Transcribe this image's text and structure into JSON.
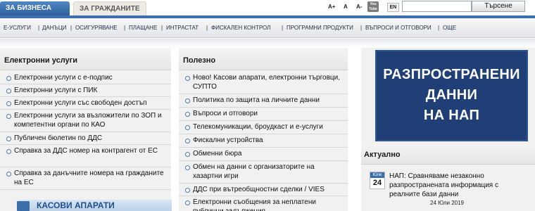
{
  "tabs": {
    "business": "ЗА БИЗНЕСА",
    "citizens": "ЗА ГРАЖДАНИТЕ"
  },
  "toolbar": {
    "font_increase": "A+",
    "font_normal": "A",
    "font_decrease": "A-",
    "youtube_top": "You",
    "youtube_bottom": "Tube",
    "language": "EN",
    "search_value": "",
    "search_button": "Търсене"
  },
  "nav": {
    "items": [
      "Е-УСЛУГИ",
      "ДАНЪЦИ",
      "ОСИГУРЯВАНЕ",
      "ПЛАЩАНЕ",
      "ИНТРАСТАТ",
      "ФИСКАЛЕН КОНТРОЛ",
      "ПРОГРАМНИ ПРОДУКТИ",
      "ВЪПРОСИ И ОТГОВОРИ",
      "ОЩЕ"
    ],
    "separator": "|"
  },
  "left_panel": {
    "title": "Електронни услуги",
    "items": [
      "Електронни услуги с е-подпис",
      "Електронни услуги с ПИК",
      "Електронни услуги със свободен достъп",
      "Електронни услуги за възложители по ЗОП и компетентни органи по КАО",
      "Публичен бюлетин по ДДС",
      "Справка за ДДС номер на контрагент от ЕС",
      "Справка за данъчните номера на гражданите на ЕС"
    ],
    "banner": "КАСОВИ АПАРАТИ"
  },
  "middle_panel": {
    "title": "Полезно",
    "items": [
      "Ново! Касови апарати, електронни търговци, СУПТО",
      "Политика по защита на личните данни",
      "Въпроси и отговори",
      "Телекомуникации, броудкаст и е-услуги",
      "Фискални устройства",
      "Обменни бюра",
      "Обмен на данни с организаторите на хазартни игри",
      "ДДС при вътреобщностни сделки / VIES",
      "Електронни съобщения за неплатени публични задължения"
    ]
  },
  "right_panel": {
    "banner_lines": [
      "РАЗПРОСТРАНЕНИ",
      "ДАННИ",
      "НА НАП"
    ],
    "section_title": "Актуално",
    "news": {
      "cal_month": "Юли",
      "cal_day": "24",
      "text": "НАП: Сравняваме незаконно разпространената информация с реалните бази данни",
      "date": "24 Юли 2019"
    }
  },
  "colors": {
    "brand_blue": "#3d6fae",
    "banner_navy": "#1f3f76",
    "tab_active": "#4f87c4"
  }
}
